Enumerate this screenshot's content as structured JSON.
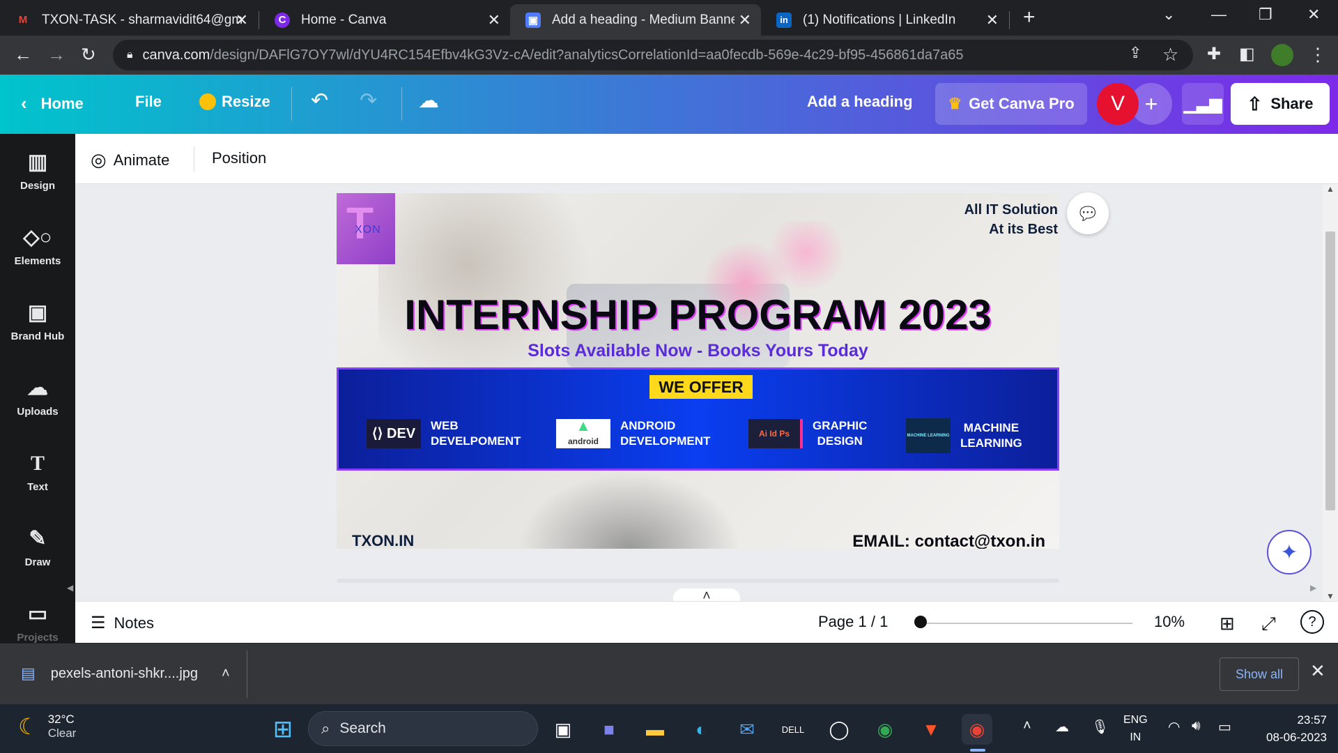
{
  "browser": {
    "tabs": [
      {
        "title": "TXON-TASK - sharmavidit64@gm",
        "favicon": "M",
        "favicon_color": "#ea4335"
      },
      {
        "title": "Home - Canva",
        "favicon": "C",
        "favicon_color": "#7d2ae8"
      },
      {
        "title": "Add a heading - Medium Banner",
        "favicon": "▣",
        "favicon_color": "#4f7cff"
      },
      {
        "title": "(1) Notifications | LinkedIn",
        "favicon": "in",
        "favicon_color": "#0a66c2"
      }
    ],
    "url_host": "canva.com",
    "url_path": "/design/DAFlG7OY7wl/dYU4RC154Efbv4kG3Vz-cA/edit?analyticsCorrelationId=aa0fecdb-569e-4c29-bf95-456861da7a65"
  },
  "canva_header": {
    "home": "Home",
    "file": "File",
    "resize": "Resize",
    "design_title": "Add a heading",
    "pro": "Get Canva Pro",
    "avatar_initial": "V",
    "share": "Share"
  },
  "sidebar": {
    "items": [
      {
        "label": "Design",
        "icon": "layout-icon"
      },
      {
        "label": "Elements",
        "icon": "shapes-icon"
      },
      {
        "label": "Brand Hub",
        "icon": "brand-icon"
      },
      {
        "label": "Uploads",
        "icon": "cloud-upload-icon"
      },
      {
        "label": "Text",
        "icon": "text-icon"
      },
      {
        "label": "Draw",
        "icon": "pen-icon"
      },
      {
        "label": "Projects",
        "icon": "folder-icon"
      }
    ]
  },
  "context_bar": {
    "animate": "Animate",
    "position": "Position"
  },
  "banner": {
    "logo_text": "XON",
    "tagline_1": "All IT Solution",
    "tagline_2": "At its Best",
    "headline": "INTERNSHIP PROGRAM 2023",
    "subline": "Slots  Available Now -  Books Yours Today",
    "offer_label": "WE OFFER",
    "offers": [
      {
        "logo": "⟨⟩ DEV",
        "line1": "WEB",
        "line2": "DEVELPOMENT"
      },
      {
        "logo": "android",
        "line1": "ANDROID",
        "line2": "DEVELOPMENT"
      },
      {
        "logo": "Ai Id Ps",
        "line1": "GRAPHIC",
        "line2": "DESIGN"
      },
      {
        "logo": "MACHINE LEARNING",
        "line1": "MACHINE",
        "line2": "LEARNING"
      }
    ],
    "site": "TXON.IN",
    "email": "EMAIL: contact@txon.in"
  },
  "footer": {
    "notes": "Notes",
    "page": "Page 1 / 1",
    "zoom": "10%"
  },
  "downloads": {
    "file": "pexels-antoni-shkr....jpg",
    "show_all": "Show all"
  },
  "taskbar": {
    "temp": "32°C",
    "condition": "Clear",
    "search": "Search",
    "lang_1": "ENG",
    "lang_2": "IN",
    "time": "23:57",
    "date": "08-06-2023"
  },
  "colors": {
    "canva_gradient_start": "#00c4cc",
    "canva_gradient_end": "#7d2ae8",
    "avatar": "#e5112e",
    "offer_band": "#0a3ef0",
    "offer_label": "#ffd91a"
  }
}
